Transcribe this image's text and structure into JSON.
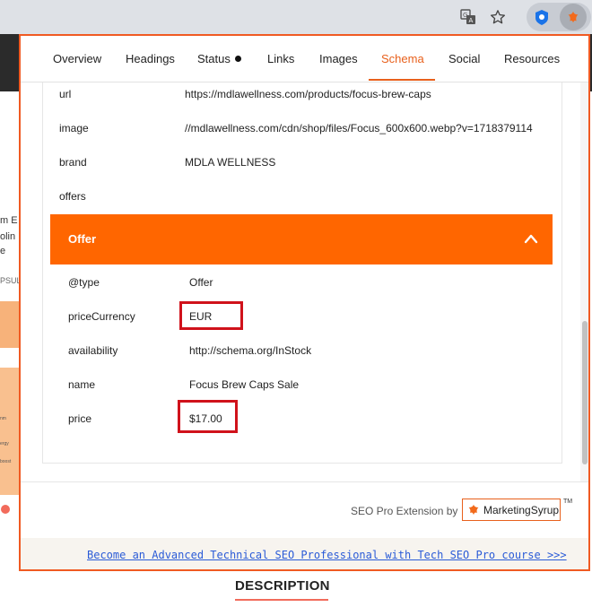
{
  "browser": {
    "icons": [
      "translate-icon",
      "star-icon",
      "extension-icon",
      "seo-pro-extension-icon"
    ]
  },
  "background_page": {
    "left_text": [
      "m E",
      "olin",
      "e",
      "PSUL"
    ],
    "left_small_text": [
      "nm",
      "ergy",
      "boost"
    ],
    "description_heading": "DESCRIPTION"
  },
  "popup": {
    "tabs": [
      {
        "label": "Overview"
      },
      {
        "label": "Headings"
      },
      {
        "label": "Status"
      },
      {
        "label": "Links"
      },
      {
        "label": "Images"
      },
      {
        "label": "Schema"
      },
      {
        "label": "Social"
      },
      {
        "label": "Resources"
      }
    ],
    "active_tab": "Schema",
    "schema_rows": [
      {
        "key": "url",
        "value": "https://mdlawellness.com/products/focus-brew-caps"
      },
      {
        "key": "image",
        "value": "//mdlawellness.com/cdn/shop/files/Focus_600x600.webp?v=1718379114"
      },
      {
        "key": "brand",
        "value": "MDLA WELLNESS"
      },
      {
        "key": "offers",
        "value": ""
      }
    ],
    "offer": {
      "title": "Offer",
      "rows": [
        {
          "key": "@type",
          "value": "Offer"
        },
        {
          "key": "priceCurrency",
          "value": "EUR"
        },
        {
          "key": "availability",
          "value": "http://schema.org/InStock"
        },
        {
          "key": "name",
          "value": "Focus Brew Caps Sale"
        },
        {
          "key": "price",
          "value": "$17.00"
        }
      ]
    },
    "footer": {
      "credit": "SEO Pro Extension by",
      "logo_text": "MarketingSyrup",
      "trademark": "TM",
      "promo_link": "Become an Advanced Technical SEO Professional with Tech SEO Pro course >>>"
    }
  },
  "colors": {
    "accent": "#ff6600",
    "active_tab": "#e8601c",
    "highlight": "#d0121b",
    "link": "#2a5bd7"
  }
}
